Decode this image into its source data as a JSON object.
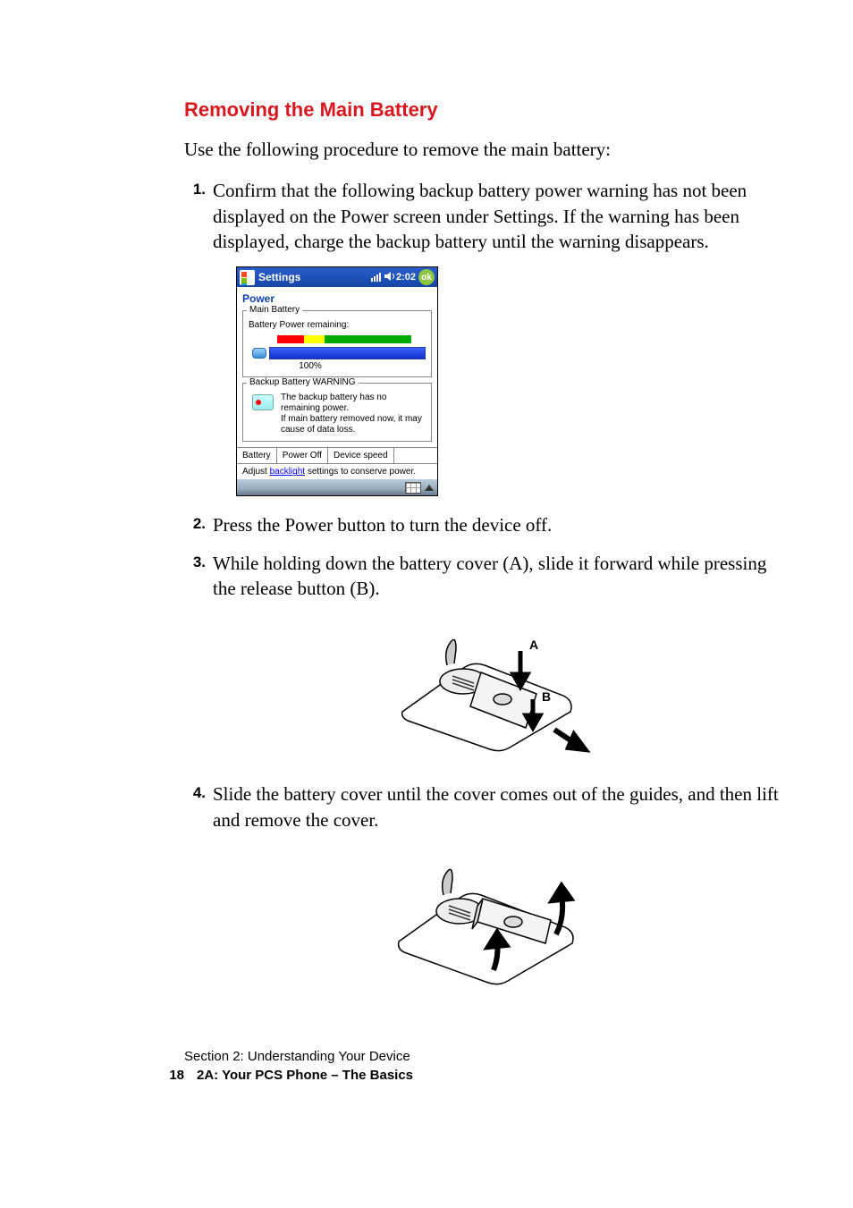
{
  "heading": "Removing the Main Battery",
  "intro": "Use the following procedure to remove the main battery:",
  "steps": [
    {
      "n": "1.",
      "text": "Confirm that the following backup battery power warning has not been displayed on the Power screen under Settings. If the warning has been displayed, charge the backup battery until the warning disappears."
    },
    {
      "n": "2.",
      "text": "Press the Power button to turn the device off."
    },
    {
      "n": "3.",
      "text": "While holding down the battery cover (A), slide it forward while pressing the release button (B)."
    },
    {
      "n": "4.",
      "text": "Slide the battery cover until the cover comes out of the guides, and then lift and remove the cover."
    }
  ],
  "ppc": {
    "title": "Settings",
    "time": "2:02",
    "ok": "ok",
    "subtitle": "Power",
    "main_legend": "Main Battery",
    "bp_remaining": "Battery Power remaining:",
    "percent": "100%",
    "backup_legend": "Backup Battery WARNING",
    "backup_text": "The backup battery has no remaining power.\nIf main battery removed now, it may cause of data loss.",
    "tabs": [
      "Battery",
      "Power Off",
      "Device speed"
    ],
    "note_pre": "Adjust ",
    "note_link": "backlight",
    "note_post": " settings to conserve power."
  },
  "fig1_labels": {
    "a": "A",
    "b": "B"
  },
  "footer": {
    "section_line": "Section 2: Understanding Your Device",
    "page_num": "18",
    "title": "2A: Your PCS Phone – The Basics"
  }
}
